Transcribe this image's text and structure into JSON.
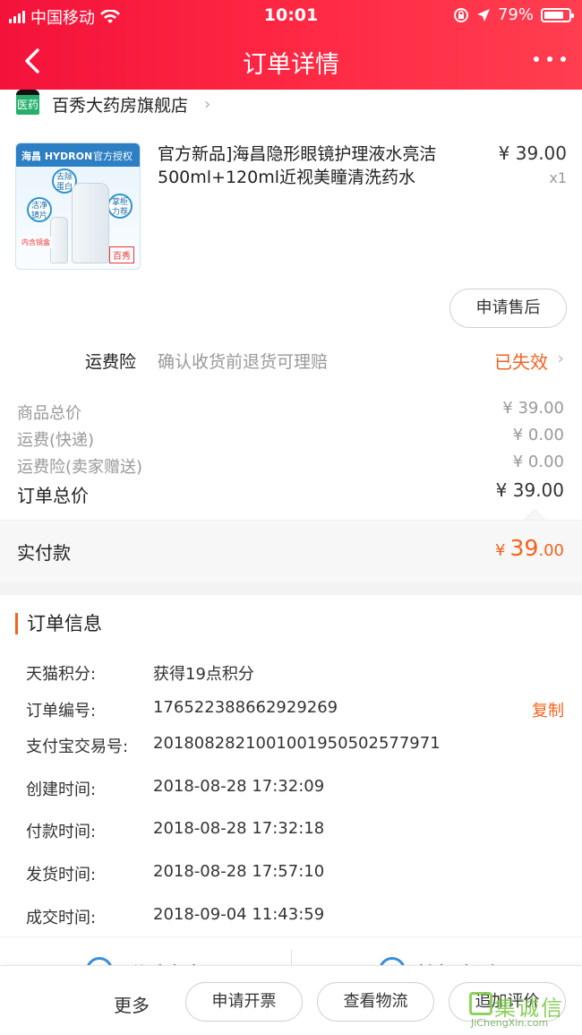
{
  "status_bar": {
    "carrier": "中国移动",
    "time": "10:01",
    "battery_percent": "79%",
    "battery_level": 0.79
  },
  "nav": {
    "title": "订单详情"
  },
  "store": {
    "badge": "医药",
    "name": "百秀大药房旗舰店"
  },
  "product": {
    "title": "官方新品]海昌隐形眼镜护理液水亮洁500ml+120ml近视美瞳清洗药水",
    "price": "¥ 39.00",
    "qty": "x1",
    "image_text": {
      "brand": "海昌 HYDRON",
      "auth": "官方授权",
      "b1": "去除蛋白",
      "b2": "洁净镜片",
      "b3": "掌柜力荐",
      "tag": "内含镜盒",
      "shop": "百秀"
    }
  },
  "actions": {
    "after_sale": "申请售后"
  },
  "insurance": {
    "label": "运费险",
    "desc": "确认收货前退货可理赔",
    "status": "已失效"
  },
  "summary": {
    "goods_label": "商品总价",
    "goods_value": "¥ 39.00",
    "ship_label": "运费(快递)",
    "ship_value": "¥ 0.00",
    "ins_label": "运费险(卖家赠送)",
    "ins_value": "¥ 0.00",
    "total_label": "订单总价",
    "total_value": "¥ 39.00",
    "paid_label": "实付款",
    "paid_symbol": "¥",
    "paid_int": "39",
    "paid_dec": ".00"
  },
  "order_info": {
    "title": "订单信息",
    "rows": [
      {
        "k": "天猫积分:",
        "v": "获得19点积分"
      },
      {
        "k": "订单编号:",
        "v": "176522388662929269",
        "action": "复制"
      },
      {
        "k": "支付宝交易号:",
        "v": "2018082821001001950502577971"
      },
      {
        "k": "创建时间:",
        "v": "2018-08-28 17:32:09"
      },
      {
        "k": "付款时间:",
        "v": "2018-08-28 17:32:18"
      },
      {
        "k": "发货时间:",
        "v": "2018-08-28 17:57:10"
      },
      {
        "k": "成交时间:",
        "v": "2018-09-04 11:43:59"
      }
    ]
  },
  "contact": {
    "seller": "联系卖家",
    "phone": "拨打电话"
  },
  "bottom": {
    "more": "更多",
    "invoice": "申请开票",
    "logistics": "查看物流",
    "review": "追加评价"
  },
  "watermark": {
    "cn": "集诚信",
    "en": "JiChengXin.com"
  },
  "colors": {
    "header_red": "#f4123a",
    "accent_orange": "#f2631e"
  }
}
